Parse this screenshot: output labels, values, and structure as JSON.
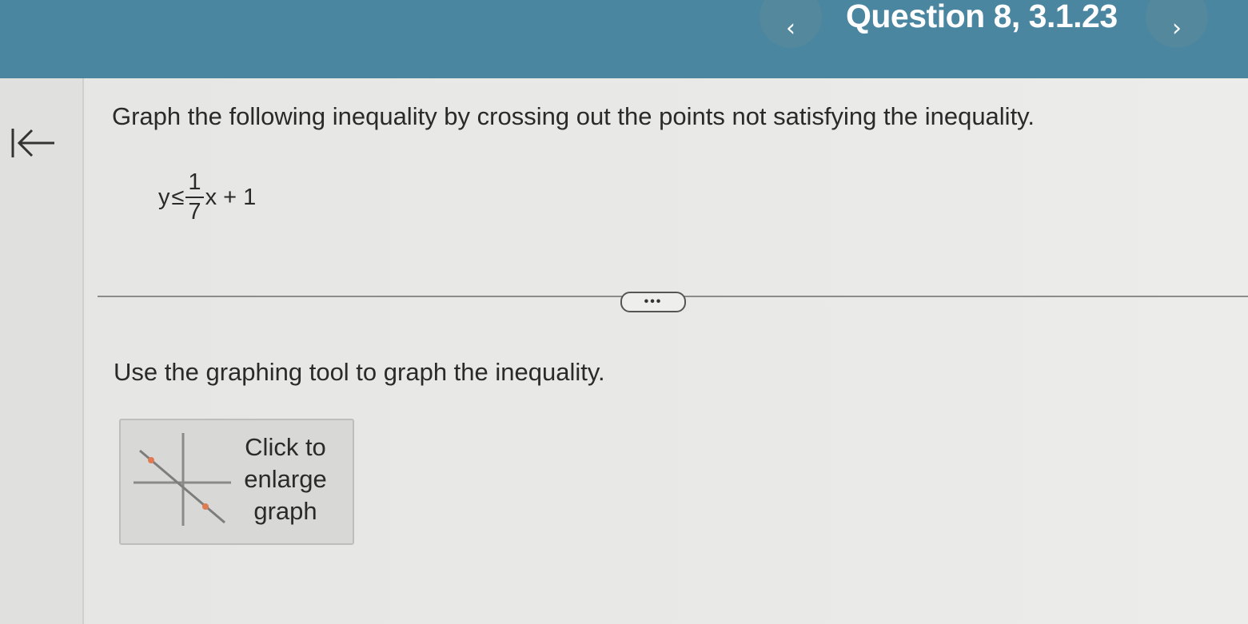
{
  "header": {
    "title": "Question 8, 3.1.23",
    "prev_glyph": "‹",
    "next_glyph": "›"
  },
  "sidebar": {
    "back_icon": "collapse-left-arrow-icon"
  },
  "question": {
    "instruction": "Graph the following inequality by crossing out the points not satisfying the inequality.",
    "equation": {
      "lhs": "y",
      "relation": "≤",
      "numerator": "1",
      "denominator": "7",
      "rhs_tail": "x + 1"
    },
    "more_label": "•••",
    "prompt": "Use the graphing tool to graph the inequality.",
    "graph_button": {
      "label": "Click to\nenlarge\ngraph",
      "icon": "graph-thumbnail-icon"
    }
  },
  "colors": {
    "header_bg": "#4a86a0",
    "page_bg": "#e6e6e4",
    "accent_point": "#e07a50"
  }
}
